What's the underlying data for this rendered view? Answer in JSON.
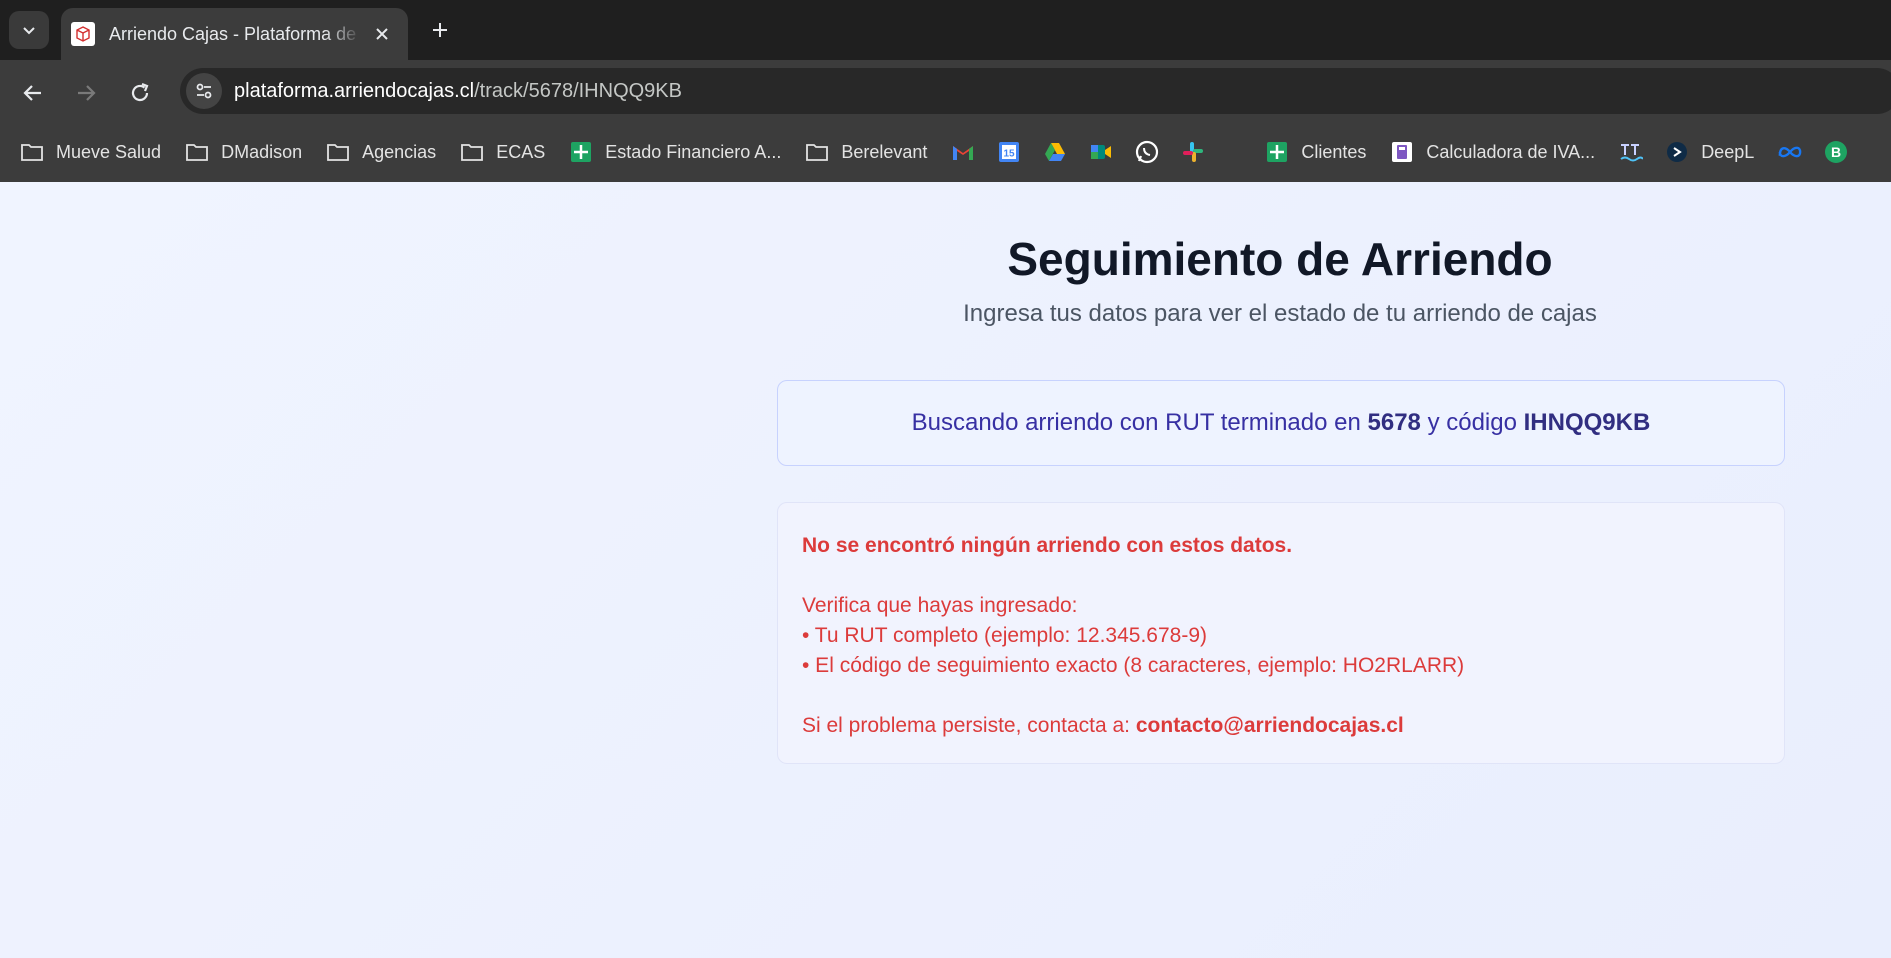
{
  "browser": {
    "tab_title": "Arriendo Cajas - Plataforma de Gestión",
    "url_host": "plataforma.arriendocajas.cl",
    "url_path": "/track/5678/IHNQQ9KB"
  },
  "bookmarks": [
    {
      "label": "Mueve Salud",
      "icon": "folder-icon"
    },
    {
      "label": "DMadison",
      "icon": "folder-icon"
    },
    {
      "label": "Agencias",
      "icon": "folder-icon"
    },
    {
      "label": "ECAS",
      "icon": "folder-icon"
    },
    {
      "label": "Estado Financiero A...",
      "icon": "sheets-icon"
    },
    {
      "label": "Berelevant",
      "icon": "folder-icon"
    },
    {
      "label": "Clientes",
      "icon": "sheets-icon"
    },
    {
      "label": "Calculadora de IVA...",
      "icon": "calculator-icon"
    },
    {
      "label": "DeepL",
      "icon": "deepl-icon"
    }
  ],
  "page": {
    "title": "Seguimiento de Arriendo",
    "subtitle": "Ingresa tus datos para ver el estado de tu arriendo de cajas",
    "search": {
      "prefix": "Buscando arriendo con RUT terminado en",
      "rut_suffix": "5678",
      "middle": "y código",
      "code": "IHNQQ9KB"
    },
    "error": {
      "headline": "No se encontró ningún arriendo con estos datos.",
      "verify_intro": "Verifica que hayas ingresado:",
      "bullet_1": "• Tu RUT completo (ejemplo: 12.345.678-9)",
      "bullet_2": "• El código de seguimiento exacto (8 caracteres, ejemplo: HO2RLARR)",
      "contact_prefix": "Si el problema persiste, contacta a:",
      "contact_email": "contacto@arriendocajas.cl"
    }
  },
  "colors": {
    "error_red": "#dc3b3b",
    "accent_indigo": "#3730a3",
    "title": "#111827"
  }
}
